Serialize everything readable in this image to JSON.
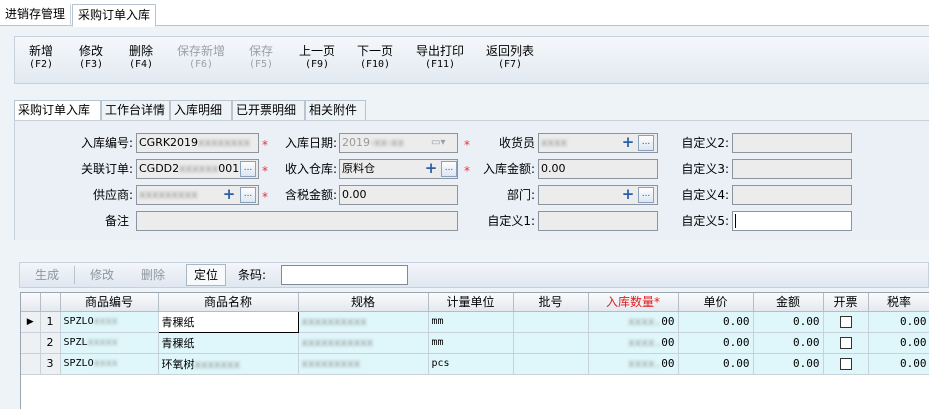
{
  "tabs_top": [
    "进销存管理",
    "采购订单入库"
  ],
  "toolbar": [
    {
      "label": "新增",
      "key": "(F2)",
      "enabled": true
    },
    {
      "label": "修改",
      "key": "(F3)",
      "enabled": true
    },
    {
      "label": "删除",
      "key": "(F4)",
      "enabled": true
    },
    {
      "label": "保存新增",
      "key": "(F6)",
      "enabled": false
    },
    {
      "label": "保存",
      "key": "(F5)",
      "enabled": false
    },
    {
      "label": "上一页",
      "key": "(F9)",
      "enabled": true
    },
    {
      "label": "下一页",
      "key": "(F10)",
      "enabled": true
    },
    {
      "label": "导出打印",
      "key": "(F11)",
      "enabled": true
    },
    {
      "label": "返回列表",
      "key": "(F7)",
      "enabled": true
    }
  ],
  "subtabs": [
    "采购订单入库",
    "工作台详情",
    "入库明细",
    "已开票明细",
    "相关附件"
  ],
  "form": {
    "receipt_no_label": "入库编号:",
    "receipt_no_value": "CGRK2019",
    "receipt_date_label": "入库日期:",
    "receipt_date_value": "2019",
    "receiver_label": "收货员",
    "custom2_label": "自定义2:",
    "related_order_label": "关联订单:",
    "related_order_value": "CGDD2",
    "related_order_suffix": "001",
    "warehouse_label": "收入仓库:",
    "warehouse_value": "原料仓",
    "amount_label": "入库金额:",
    "amount_value": "0.00",
    "custom3_label": "自定义3:",
    "supplier_label": "供应商:",
    "tax_amount_label": "含税金额:",
    "tax_amount_value": "0.00",
    "dept_label": "部门:",
    "custom4_label": "自定义4:",
    "remark_label": "备注",
    "custom1_label": "自定义1:",
    "custom5_label": "自定义5:"
  },
  "grid_toolbar": {
    "generate": "生成",
    "edit": "修改",
    "delete": "删除",
    "locate": "定位",
    "barcode_label": "条码:"
  },
  "table": {
    "headers": [
      "商品编号",
      "商品名称",
      "规格",
      "计量单位",
      "批号",
      "入库数量*",
      "单价",
      "金额",
      "开票",
      "税率"
    ],
    "rows": [
      {
        "marker": "▶",
        "idx": "1",
        "code": "SPZLO",
        "name": "青稞纸",
        "unit": "mm",
        "qty_tail": "00",
        "price": "0.00",
        "amount": "0.00",
        "tax": "0.00"
      },
      {
        "marker": "",
        "idx": "2",
        "code": "SPZL",
        "name": "青稞纸",
        "unit": "mm",
        "qty_tail": "00",
        "price": "0.00",
        "amount": "0.00",
        "tax": "0.00"
      },
      {
        "marker": "",
        "idx": "3",
        "code": "SPZLO",
        "name": "环氧树",
        "unit": "pcs",
        "qty_tail": "00",
        "price": "0.00",
        "amount": "0.00",
        "tax": "0.00"
      }
    ]
  }
}
